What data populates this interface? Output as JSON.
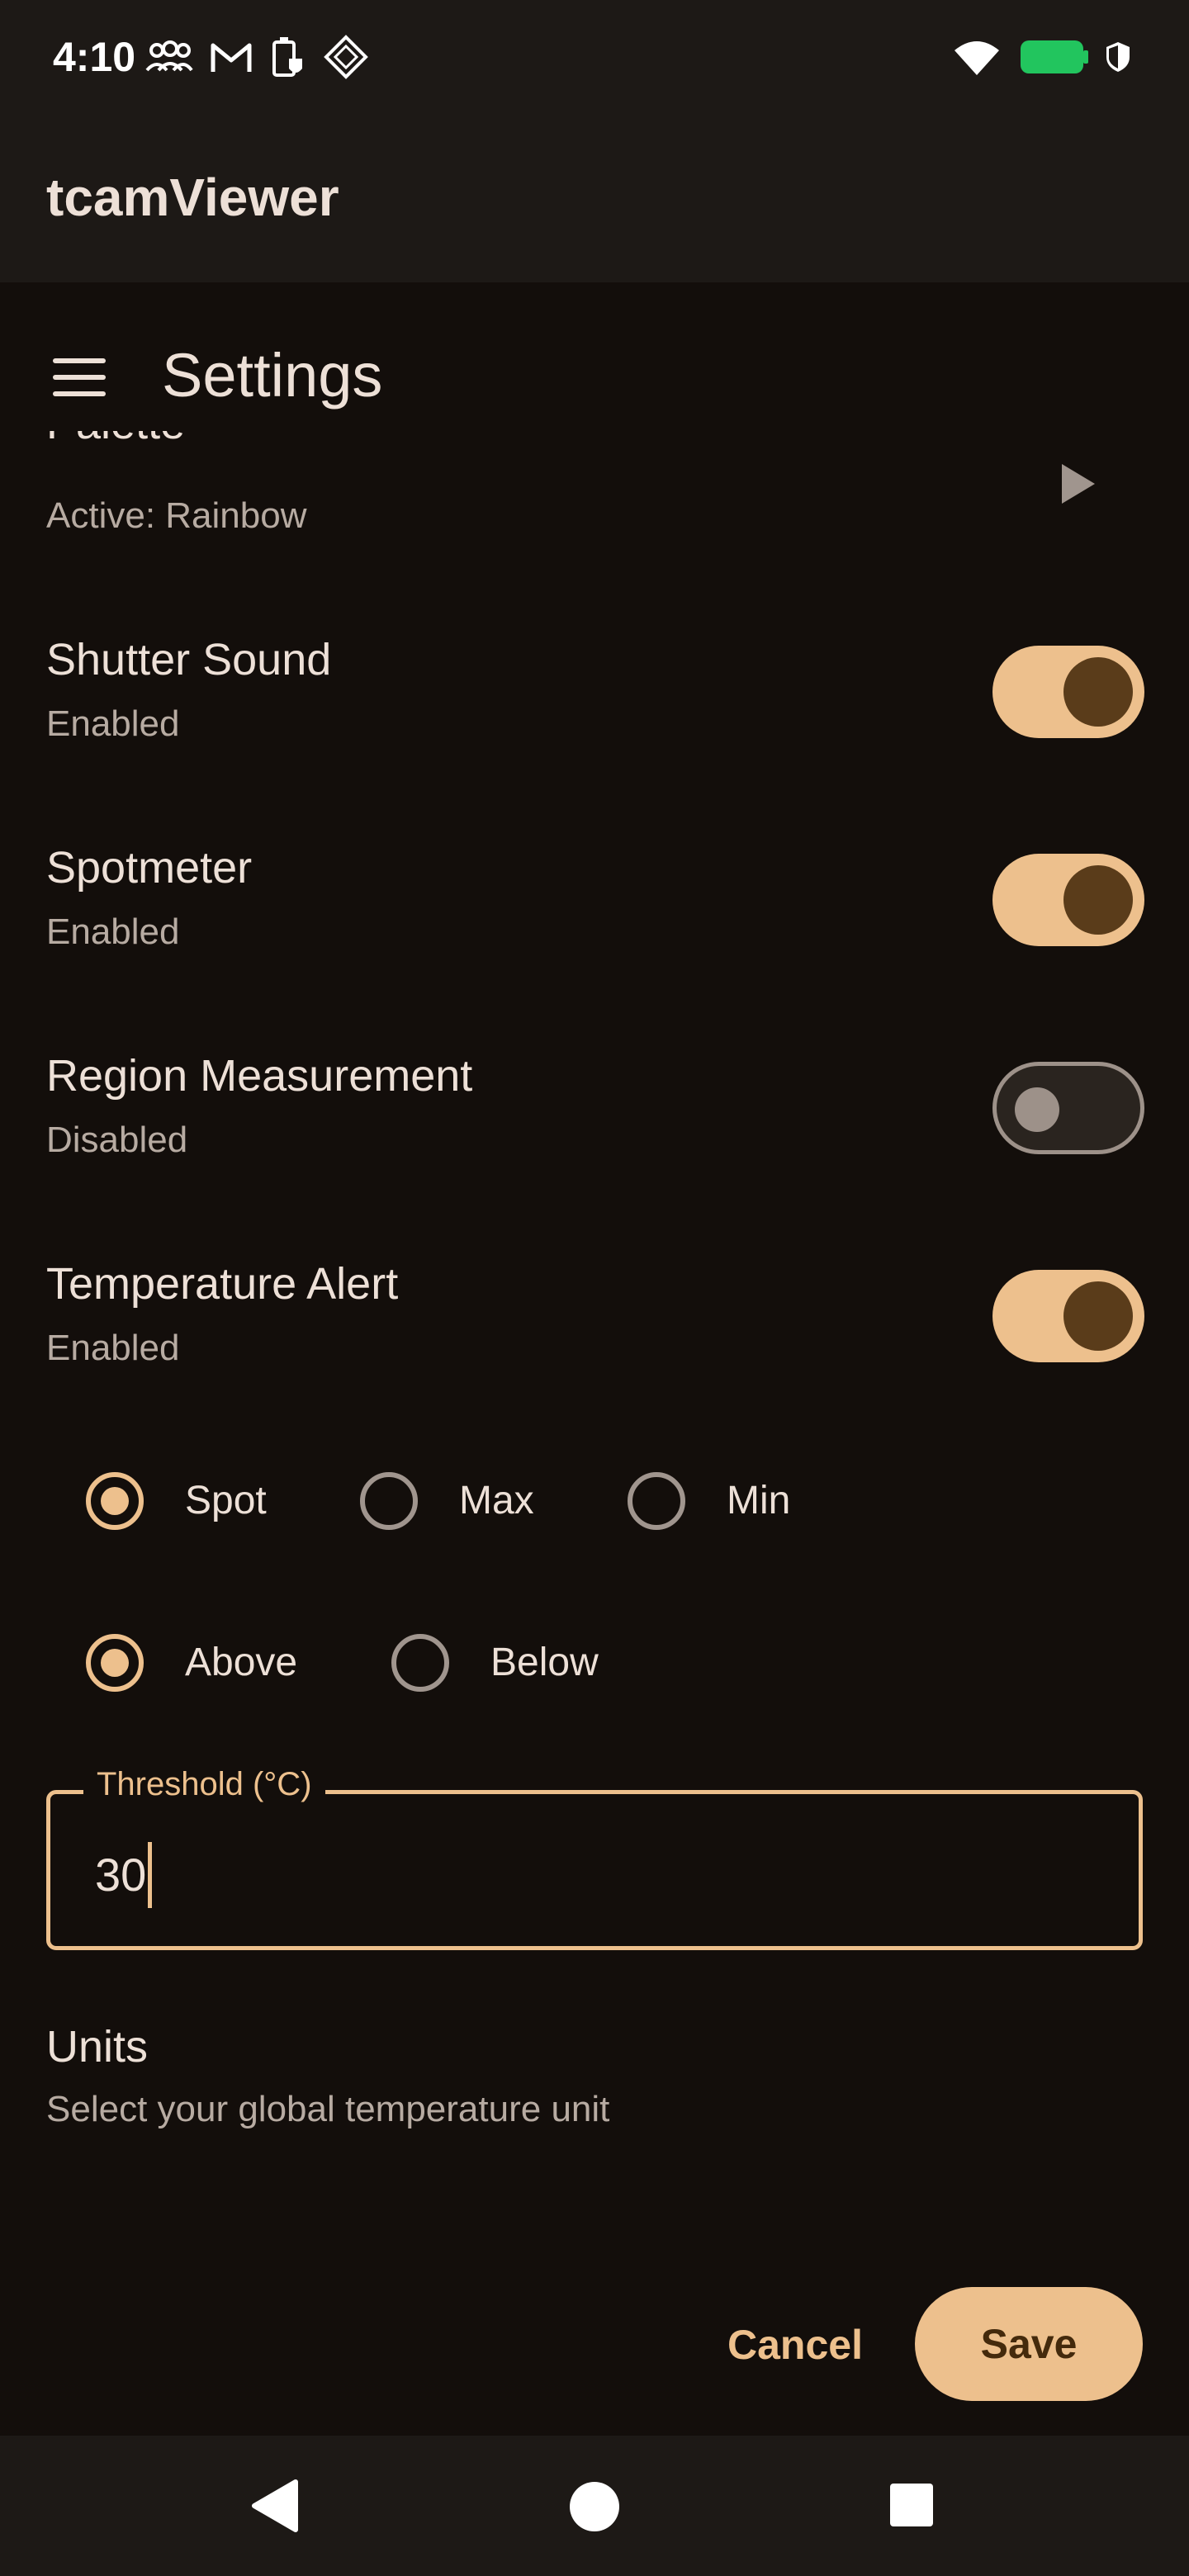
{
  "status_bar": {
    "time": "4:10",
    "left_icons": [
      "people-icon",
      "gmail-icon",
      "battery-saver-icon",
      "diamond-app-icon"
    ],
    "right_icons": [
      "wifi-icon",
      "battery-icon",
      "shield-icon"
    ]
  },
  "app_bar": {
    "title": "tcamViewer"
  },
  "settings_header": {
    "title": "Settings"
  },
  "palette": {
    "title": "Palette",
    "subtitle": "Active: Rainbow"
  },
  "shutter_sound": {
    "title": "Shutter Sound",
    "subtitle": "Enabled",
    "on": true
  },
  "spotmeter": {
    "title": "Spotmeter",
    "subtitle": "Enabled",
    "on": true
  },
  "region_measurement": {
    "title": "Region Measurement",
    "subtitle": "Disabled",
    "on": false
  },
  "temperature_alert": {
    "title": "Temperature Alert",
    "subtitle": "Enabled",
    "on": true
  },
  "alert_source": {
    "options": [
      "Spot",
      "Max",
      "Min"
    ],
    "selected": "Spot"
  },
  "alert_direction": {
    "options": [
      "Above",
      "Below"
    ],
    "selected": "Above"
  },
  "threshold": {
    "label": "Threshold (°C)",
    "value": "30"
  },
  "units": {
    "title": "Units",
    "subtitle": "Select your global temperature unit"
  },
  "actions": {
    "cancel": "Cancel",
    "save": "Save"
  },
  "colors": {
    "accent": "#edc08d",
    "background": "#130e0b",
    "surface": "#1d1916",
    "battery": "#22c55e"
  }
}
